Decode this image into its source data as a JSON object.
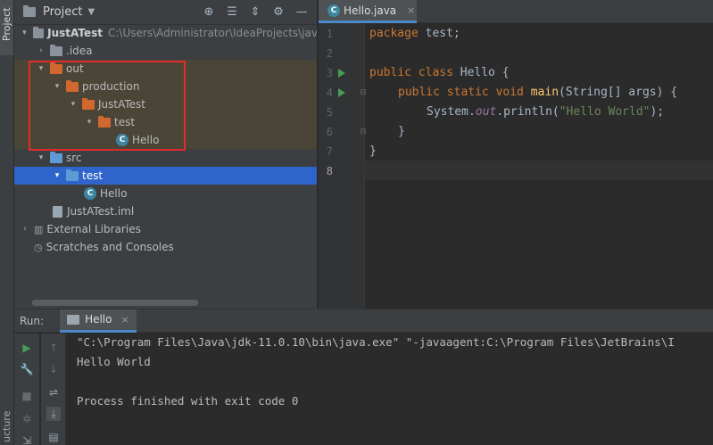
{
  "left_strip": {
    "project_tab": "Project",
    "structure_tab": "ucture"
  },
  "project_panel": {
    "title": "Project",
    "caret": "▼",
    "header_icons": [
      "globe-icon",
      "collapse-all-icon",
      "expand-all-icon",
      "settings-icon",
      "minimize-icon"
    ],
    "tree": [
      {
        "label": "JustATest",
        "path": "C:\\Users\\Administrator\\IdeaProjects\\jav",
        "arrow": "▾",
        "icon": "folder-grey",
        "bold": true
      },
      {
        "label": ".idea",
        "arrow": "›",
        "icon": "folder-grey"
      },
      {
        "label": "out",
        "arrow": "▾",
        "icon": "folder-orange"
      },
      {
        "label": "production",
        "arrow": "▾",
        "icon": "folder-orange"
      },
      {
        "label": "JustATest",
        "arrow": "▾",
        "icon": "folder-orange"
      },
      {
        "label": "test",
        "arrow": "▾",
        "icon": "folder-orange"
      },
      {
        "label": "Hello",
        "arrow": "",
        "icon": "class"
      },
      {
        "label": "src",
        "arrow": "▾",
        "icon": "folder-blue"
      },
      {
        "label": "test",
        "arrow": "▾",
        "icon": "folder-blue"
      },
      {
        "label": "Hello",
        "arrow": "",
        "icon": "class"
      },
      {
        "label": "JustATest.iml",
        "arrow": "",
        "icon": "file"
      },
      {
        "label": "External Libraries",
        "arrow": "›",
        "icon": "library"
      },
      {
        "label": "Scratches and Consoles",
        "arrow": "",
        "icon": "scratch"
      }
    ]
  },
  "editor": {
    "tab_label": "Hello.java",
    "tab_close": "×",
    "line_numbers": [
      "1",
      "2",
      "3",
      "4",
      "5",
      "6",
      "7",
      "8"
    ],
    "code": {
      "l1_kw": "package",
      "l1_rest": " test;",
      "l3_kw": "public class",
      "l3_rest": " Hello {",
      "l4_kw": "public static void",
      "l4_fn": "main",
      "l4_rest": "(String[] args) {",
      "l5_a": "System.",
      "l5_fld": "out",
      "l5_b": ".println(",
      "l5_str": "\"Hello World\"",
      "l5_c": ");",
      "l6": "}",
      "l7": "}"
    }
  },
  "run_panel": {
    "label": "Run:",
    "tab_label": "Hello",
    "tab_close": "×",
    "console": [
      "\"C:\\Program Files\\Java\\jdk-11.0.10\\bin\\java.exe\" \"-javaagent:C:\\Program Files\\JetBrains\\I",
      "Hello World",
      "",
      "Process finished with exit code 0"
    ]
  },
  "colors": {
    "accent": "#2f65ca",
    "highlight_box": "#e22b2b",
    "keyword": "#cc7832",
    "string": "#6a8759"
  }
}
